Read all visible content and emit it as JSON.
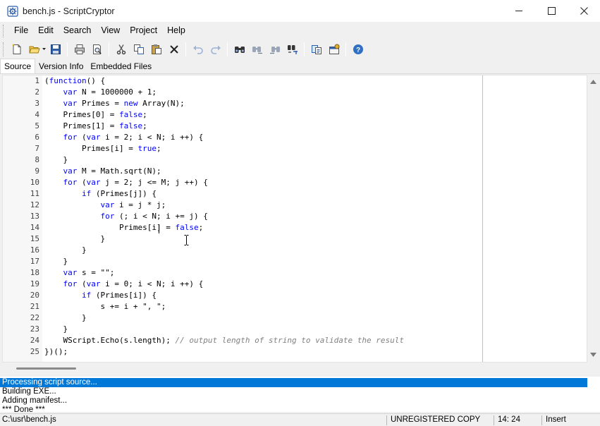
{
  "window": {
    "title": "bench.js - ScriptCryptor",
    "controls": {
      "minimize_icon": "minimize-icon",
      "maximize_icon": "maximize-icon",
      "close_icon": "close-icon"
    }
  },
  "menu": [
    "File",
    "Edit",
    "Search",
    "View",
    "Project",
    "Help"
  ],
  "toolbar": {
    "icons": [
      "new-file-icon",
      "open-file-icon",
      "save-icon",
      "print-icon",
      "print-preview-icon",
      "cut-icon",
      "copy-icon",
      "paste-icon",
      "delete-icon",
      "undo-icon",
      "redo-icon",
      "find-icon",
      "find-next-icon",
      "find-previous-icon",
      "replace-icon",
      "build-icon",
      "project-options-icon",
      "help-icon"
    ]
  },
  "tabs": [
    "Source",
    "Version Info",
    "Embedded Files"
  ],
  "editor": {
    "line_numbers": [
      "1",
      "2",
      "3",
      "4",
      "5",
      "6",
      "7",
      "8",
      "9",
      "10",
      "11",
      "12",
      "13",
      "14",
      "15",
      "16",
      "17",
      "18",
      "19",
      "20",
      "21",
      "22",
      "23",
      "24",
      "25"
    ],
    "lines": [
      "(function() {",
      "    var N = 1000000 + 1;",
      "    var Primes = new Array(N);",
      "    Primes[0] = false;",
      "    Primes[1] = false;",
      "    for (var i = 2; i < N; i ++) {",
      "        Primes[i] = true;",
      "    }",
      "    var M = Math.sqrt(N);",
      "    for (var j = 2; j <= M; j ++) {",
      "        if (Primes[j]) {",
      "            var i = j * j;",
      "            for (; i < N; i += j) {",
      "                Primes[i] = false;",
      "            }",
      "        }",
      "    }",
      "    var s = \"\";",
      "    for (var i = 0; i < N; i ++) {",
      "        if (Primes[i]) {",
      "            s += i + \", \";",
      "        }",
      "    }",
      "    WScript.Echo(s.length); // output length of string to validate the result",
      "})();"
    ],
    "colors": {
      "keyword": "#0000ff",
      "comment": "#808080",
      "text": "#000000"
    }
  },
  "output": {
    "lines": [
      "Processing script source...",
      "Building EXE...",
      "Adding manifest...",
      "*** Done ***"
    ],
    "selected_color": "#0078d7"
  },
  "status": {
    "path": "C:\\usr\\bench.js",
    "registration": "UNREGISTERED COPY",
    "position": "14: 24",
    "mode": "Insert"
  }
}
